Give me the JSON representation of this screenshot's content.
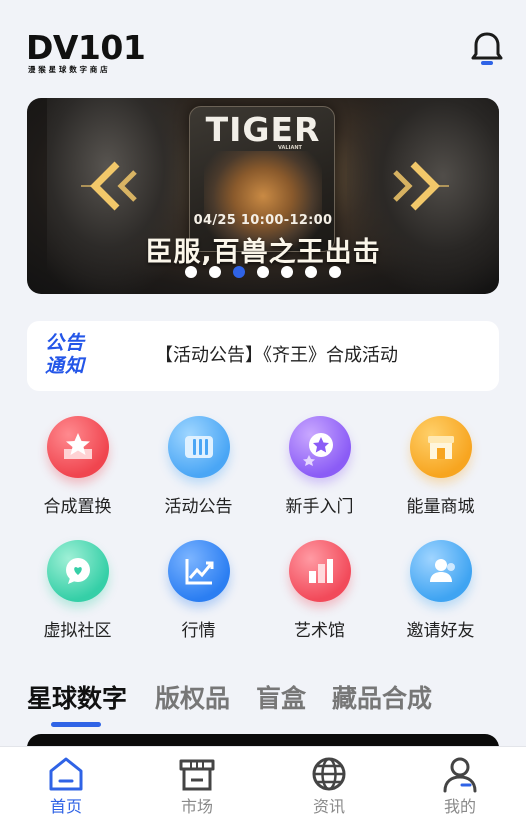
{
  "header": {
    "logo_text": "DV101",
    "logo_subtitle": "漫猴星球数字商店",
    "bell_icon": "bell-icon"
  },
  "banner": {
    "poster_title": "TIGER",
    "poster_subtitle": "VALIANT",
    "date_text": "04/25 10:00-12:00",
    "headline": "臣服,百兽之王出击",
    "dots_total": 7,
    "active_dot_index": 2,
    "colors": {
      "active_dot": "#2f63e6",
      "inactive_dot": "#ffffff",
      "chevron": "#f2c86a"
    }
  },
  "notice": {
    "badge_line1": "公告",
    "badge_line2": "通知",
    "text": "【活动公告】《齐王》合成活动"
  },
  "grid": {
    "items": [
      {
        "label": "合成置换",
        "icon": "star-card-icon",
        "color": "#f0454f"
      },
      {
        "label": "活动公告",
        "icon": "ticket-icon",
        "color": "#4aa6f5"
      },
      {
        "label": "新手入门",
        "icon": "star-badge-icon",
        "color": "#8b5cf6"
      },
      {
        "label": "能量商城",
        "icon": "shop-icon",
        "color": "#f7a520"
      },
      {
        "label": "虚拟社区",
        "icon": "chat-icon",
        "color": "#35cfa7"
      },
      {
        "label": "行情",
        "icon": "trend-chart-icon",
        "color": "#2b7ef2"
      },
      {
        "label": "艺术馆",
        "icon": "bar-building-icon",
        "color": "#f24a5a"
      },
      {
        "label": "邀请好友",
        "icon": "friends-icon",
        "color": "#3fa4f2"
      }
    ]
  },
  "categories": {
    "items": [
      "星球数字",
      "版权品",
      "盲盒",
      "藏品合成"
    ],
    "active_index": 0,
    "accent": "#2f63e6"
  },
  "bottom_nav": {
    "items": [
      {
        "label": "首页",
        "icon": "home-icon"
      },
      {
        "label": "市场",
        "icon": "store-icon"
      },
      {
        "label": "资讯",
        "icon": "globe-icon"
      },
      {
        "label": "我的",
        "icon": "user-icon"
      }
    ],
    "active_index": 0,
    "accent": "#2f63e6"
  }
}
